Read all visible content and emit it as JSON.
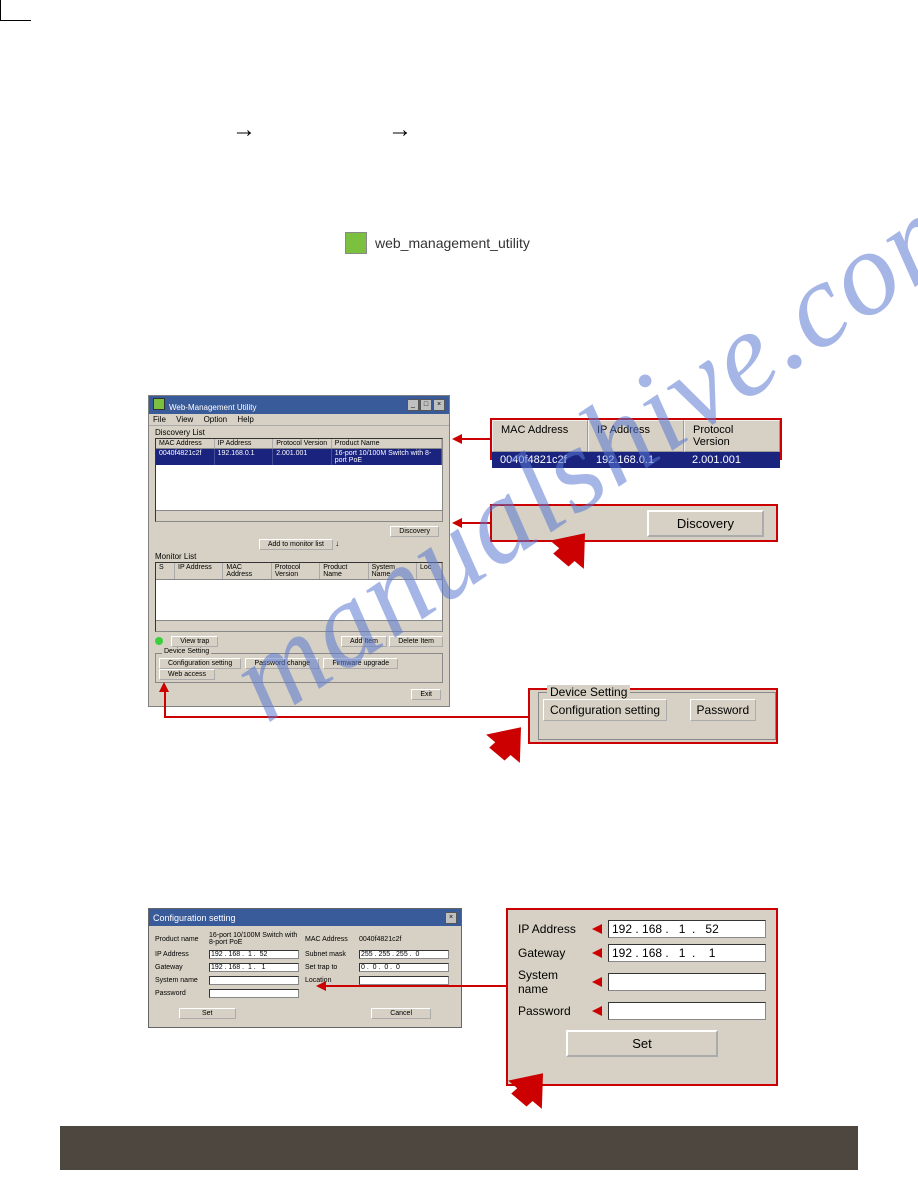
{
  "arrows": {
    "a1": "→",
    "a2": "→"
  },
  "shortcut": {
    "label": "web_management_utility"
  },
  "util": {
    "title": "Web-Management Utility",
    "menus": [
      "File",
      "View",
      "Option",
      "Help"
    ],
    "discovery_label": "Discovery List",
    "discovery_cols": [
      "MAC Address",
      "IP Address",
      "Protocol Version",
      "Product Name"
    ],
    "discovery_row": [
      "0040f4821c2f",
      "192.168.0.1",
      "2.001.001",
      "16-port 10/100M Switch with 8-port PoE"
    ],
    "discovery_btn": "Discovery",
    "add_monitor_btn": "Add to monitor list",
    "monitor_label": "Monitor List",
    "monitor_cols": [
      "S",
      "IP Address",
      "MAC Address",
      "Protocol Version",
      "Product Name",
      "System Name",
      "Loc"
    ],
    "viewtrap_btn": "View trap",
    "additem_btn": "Add Item",
    "deleteitem_btn": "Delete Item",
    "device_setting_label": "Device Setting",
    "cfg_btn": "Configuration setting",
    "pwd_btn": "Password change",
    "fw_btn": "Firmware upgrade",
    "web_btn": "Web access",
    "exit_btn": "Exit"
  },
  "callout1": {
    "cols": [
      "MAC Address",
      "IP Address",
      "Protocol Version"
    ],
    "row": [
      "0040f4821c2f",
      "192.168.0.1",
      "2.001.001"
    ]
  },
  "callout2": {
    "btn": "Discovery"
  },
  "callout3": {
    "legend": "Device Setting",
    "cfg": "Configuration setting",
    "pwd": "Password"
  },
  "cfg": {
    "title": "Configuration setting",
    "product_lbl": "Product name",
    "product_val": "16-port 10/100M Switch with 8-port PoE",
    "mac_lbl": "MAC Address",
    "mac_val": "0040f4821c2f",
    "ip_lbl": "IP Address",
    "ip_val": "192 . 168 .  1 .  52",
    "subnet_lbl": "Subnet mask",
    "subnet_val": "255 . 255 . 255 .  0",
    "gw_lbl": "Gateway",
    "gw_val": "192 . 168 .  1 .   1",
    "trap_lbl": "Set trap to",
    "trap_val": "0 .  0 .  0 .  0",
    "sys_lbl": "System name",
    "sys_val": "",
    "loc_lbl": "Location",
    "loc_val": "",
    "pwd_lbl": "Password",
    "pwd_val": "",
    "set_btn": "Set",
    "cancel_btn": "Cancel"
  },
  "callout4": {
    "ip_lbl": "IP Address",
    "ip_val": "192 . 168 .   1  .   52",
    "gw_lbl": "Gateway",
    "gw_val": "192 . 168 .   1  .    1",
    "sys_lbl": "System name",
    "sys_val": "",
    "pwd_lbl": "Password",
    "pwd_val": "",
    "set_btn": "Set"
  },
  "watermark": "manualshive.com"
}
